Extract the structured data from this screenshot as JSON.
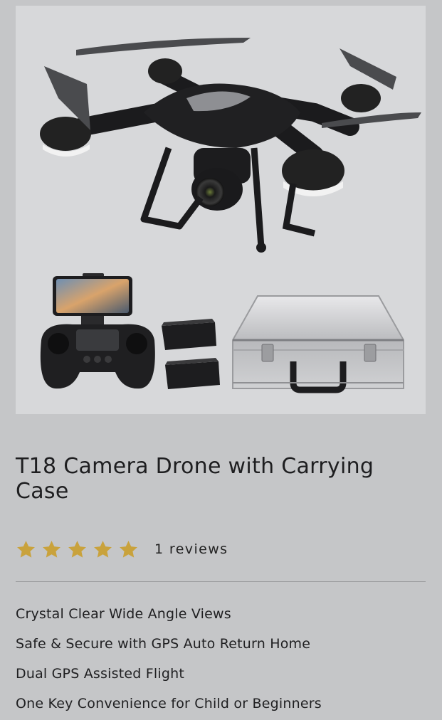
{
  "product": {
    "title": "T18 Camera Drone with Carrying Case",
    "rating_value": 5,
    "rating_max": 5,
    "reviews_label": "1 reviews",
    "features": [
      "Crystal Clear Wide Angle Views",
      "Safe & Secure with GPS Auto Return Home",
      "Dual GPS Assisted Flight",
      "One Key Convenience for Child or Beginners"
    ]
  },
  "colors": {
    "page_background": "#c5c6c8",
    "image_background": "#d7d8da",
    "star": "#c9a23c",
    "text": "#1e1e20"
  },
  "icons": {
    "rating_star": "star-icon"
  }
}
